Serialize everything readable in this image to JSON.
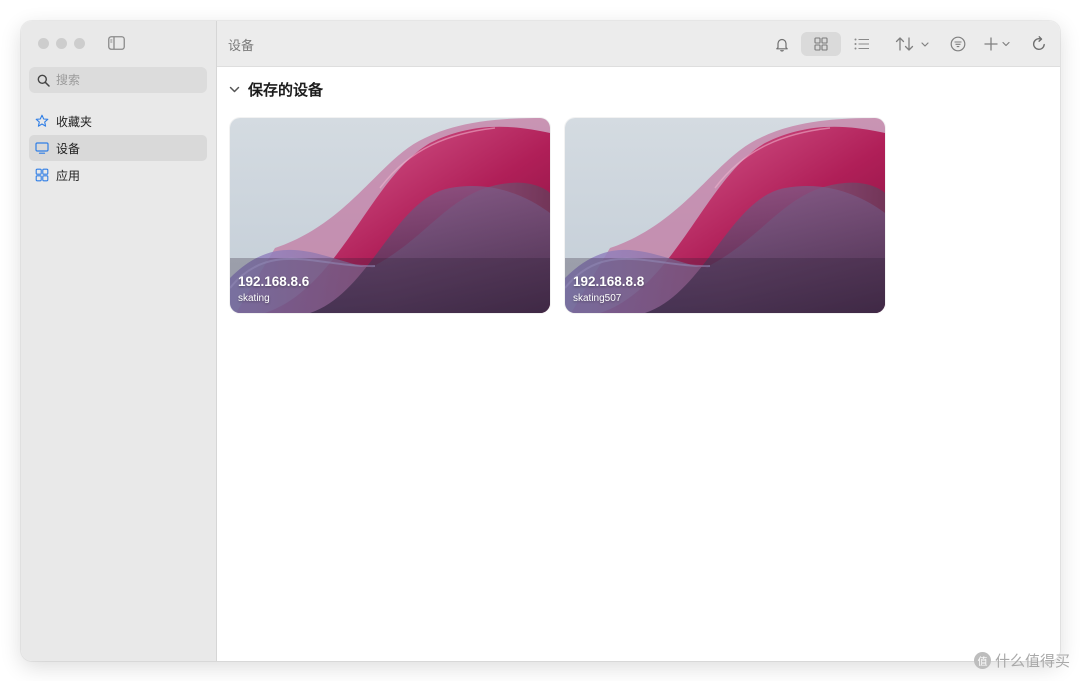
{
  "sidebar": {
    "search_placeholder": "搜索",
    "items": [
      {
        "label": "收藏夹",
        "icon": "star-icon",
        "active": false
      },
      {
        "label": "设备",
        "icon": "display-icon",
        "active": true
      },
      {
        "label": "应用",
        "icon": "apps-grid-icon",
        "active": false
      }
    ]
  },
  "toolbar": {
    "title": "设备",
    "icons": [
      "bell-icon",
      "grid-view-icon",
      "list-view-icon",
      "sort-icon",
      "filter-icon",
      "add-icon",
      "refresh-icon"
    ]
  },
  "main": {
    "section_title": "保存的设备",
    "devices": [
      {
        "ip": "192.168.8.6",
        "name": "skating"
      },
      {
        "ip": "192.168.8.8",
        "name": "skating507"
      }
    ]
  },
  "watermark": {
    "badge": "值",
    "text": "什么值得买"
  },
  "colors": {
    "accent": "#2f7ee6",
    "sidebar_bg": "#e9e9e9",
    "toolbar_bg": "#ececec"
  }
}
